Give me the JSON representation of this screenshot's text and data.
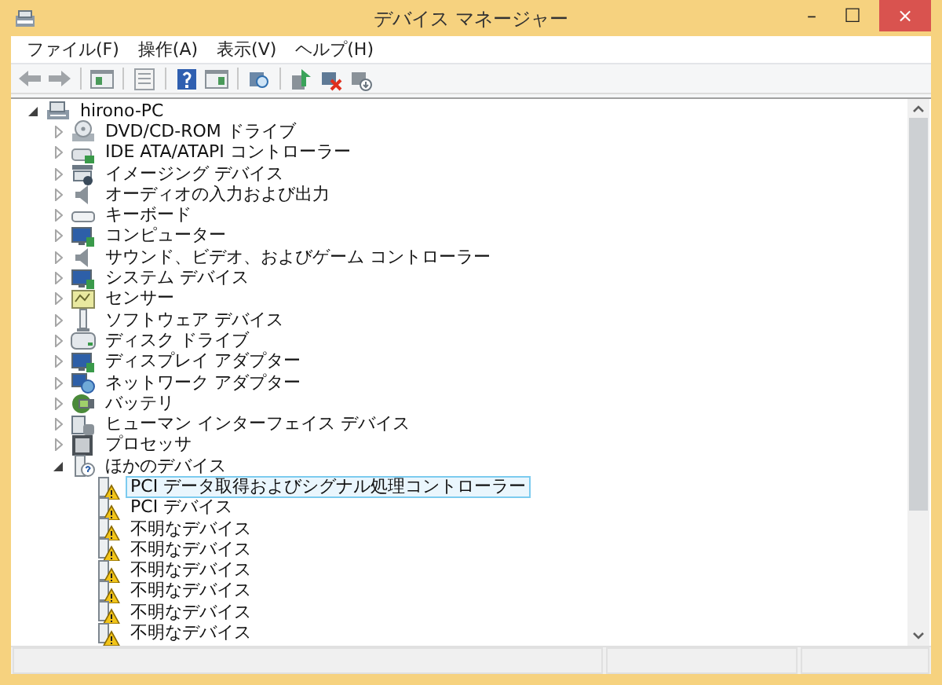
{
  "window": {
    "title": "デバイス マネージャー",
    "controls": [
      "–",
      "☐",
      "×"
    ]
  },
  "menu": [
    "ファイル(F)",
    "操作(A)",
    "表示(V)",
    "ヘルプ(H)"
  ],
  "tree": [
    {
      "label": "hirono-PC",
      "kind": "computer",
      "expanded": true,
      "selected": false,
      "children": [
        {
          "label": "DVD/CD-ROM ドライブ",
          "kind": "dvd",
          "expanded": false,
          "selected": false
        },
        {
          "label": "IDE ATA/ATAPI コントローラー",
          "kind": "ide",
          "expanded": false,
          "selected": false
        },
        {
          "label": "イメージング デバイス",
          "kind": "camera",
          "expanded": false,
          "selected": false
        },
        {
          "label": "オーディオの入力および出力",
          "kind": "speaker",
          "expanded": false,
          "selected": false
        },
        {
          "label": "キーボード",
          "kind": "keyboard",
          "expanded": false,
          "selected": false
        },
        {
          "label": "コンピューター",
          "kind": "monitor",
          "expanded": false,
          "selected": false
        },
        {
          "label": "サウンド、ビデオ、およびゲーム コントローラー",
          "kind": "speaker",
          "expanded": false,
          "selected": false
        },
        {
          "label": "システム デバイス",
          "kind": "monitor",
          "expanded": false,
          "selected": false
        },
        {
          "label": "センサー",
          "kind": "sensor",
          "expanded": false,
          "selected": false
        },
        {
          "label": "ソフトウェア デバイス",
          "kind": "software",
          "expanded": false,
          "selected": false
        },
        {
          "label": "ディスク ドライブ",
          "kind": "disk",
          "expanded": false,
          "selected": false
        },
        {
          "label": "ディスプレイ アダプター",
          "kind": "monitor",
          "expanded": false,
          "selected": false
        },
        {
          "label": "ネットワーク アダプター",
          "kind": "network",
          "expanded": false,
          "selected": false
        },
        {
          "label": "バッテリ",
          "kind": "battery",
          "expanded": false,
          "selected": false
        },
        {
          "label": "ヒューマン インターフェイス デバイス",
          "kind": "hid",
          "expanded": false,
          "selected": false
        },
        {
          "label": "プロセッサ",
          "kind": "processor",
          "expanded": false,
          "selected": false
        },
        {
          "label": "ほかのデバイス",
          "kind": "unknown",
          "expanded": true,
          "selected": false,
          "children": [
            {
              "label": "PCI データ取得およびシグナル処理コントローラー",
              "kind": "warning",
              "selected": true
            },
            {
              "label": "PCI デバイス",
              "kind": "warning",
              "selected": false
            },
            {
              "label": "不明なデバイス",
              "kind": "warning",
              "selected": false
            },
            {
              "label": "不明なデバイス",
              "kind": "warning",
              "selected": false
            },
            {
              "label": "不明なデバイス",
              "kind": "warning",
              "selected": false
            },
            {
              "label": "不明なデバイス",
              "kind": "warning",
              "selected": false
            },
            {
              "label": "不明なデバイス",
              "kind": "warning",
              "selected": false
            },
            {
              "label": "不明なデバイス",
              "kind": "warning",
              "selected": false
            }
          ]
        }
      ]
    }
  ]
}
